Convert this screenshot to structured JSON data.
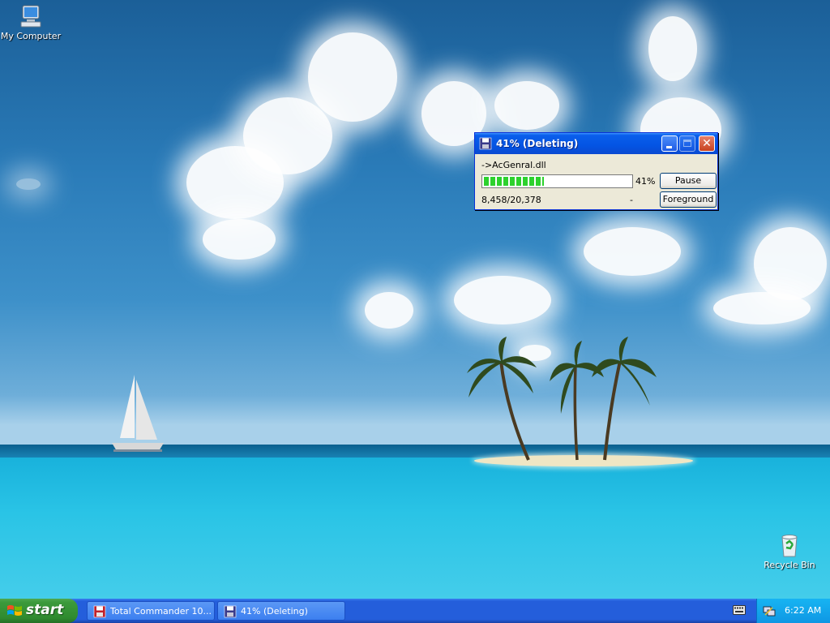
{
  "desktop": {
    "icons": [
      {
        "label": "My Computer"
      },
      {
        "label": "Recycle Bin"
      }
    ]
  },
  "dialog": {
    "title": "41%  (Deleting)",
    "current_file": "->AcGenral.dll",
    "progress_fraction": 0.41,
    "progress_label": "41%",
    "counts": "8,458/20,378",
    "separator": "-",
    "pause_label": "Pause",
    "foreground_label": "Foreground",
    "close_glyph": "✕"
  },
  "taskbar": {
    "start_label": "start",
    "tasks": [
      {
        "label": "Total Commander 10...."
      },
      {
        "label": "41%  (Deleting)"
      }
    ],
    "clock": "6:22 AM"
  }
}
